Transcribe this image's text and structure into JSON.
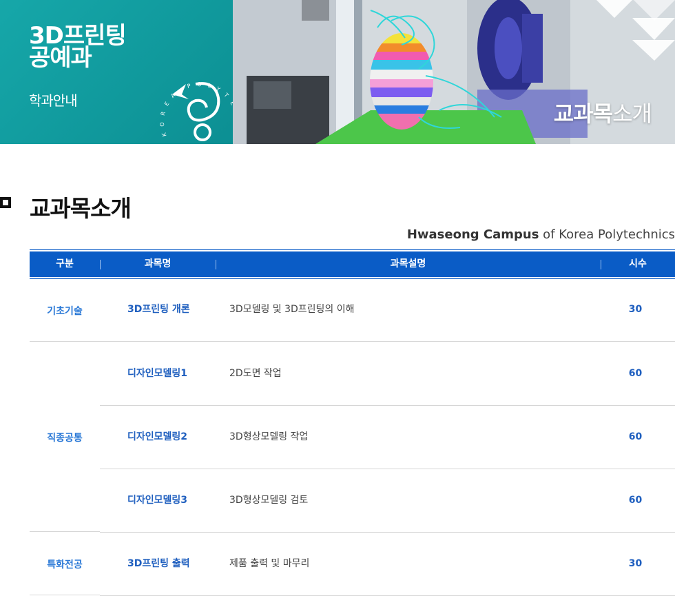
{
  "banner": {
    "dept_line1": "3D프린팅",
    "dept_line2": "공예과",
    "dept_sub": "학과안내",
    "seal_text": "KOREA POLYTECHNICS",
    "caption_bold": "교과목",
    "caption_thin": "소개"
  },
  "section": {
    "title": "교과목소개",
    "campus_bold": "Hwaseong Campus",
    "campus_rest": " of Korea Polytechnics"
  },
  "table": {
    "headers": [
      "구분",
      "과목명",
      "과목설명",
      "시수"
    ],
    "categories": [
      {
        "label": "기초기술"
      },
      {
        "label": "직종공통"
      },
      {
        "label": "특화전공"
      }
    ],
    "rows": [
      {
        "name": "3D프린팅 개론",
        "desc": "3D모델링 및 3D프린팅의 이해",
        "hours": "30"
      },
      {
        "name": "디자인모델링1",
        "desc": "2D도면 작업",
        "hours": "60"
      },
      {
        "name": "디자인모델링2",
        "desc": "3D형상모델링 작업",
        "hours": "60"
      },
      {
        "name": "디자인모델링3",
        "desc": "3D형상모델링 검토",
        "hours": "60"
      },
      {
        "name": "3D프린팅 출력",
        "desc": "제품 출력 및 마무리",
        "hours": "30"
      }
    ]
  },
  "colors": {
    "teal": "#0c8f93",
    "header_blue": "#0a5cc6",
    "accent_blue": "#1f5fbf",
    "category_blue": "#2877d6"
  }
}
